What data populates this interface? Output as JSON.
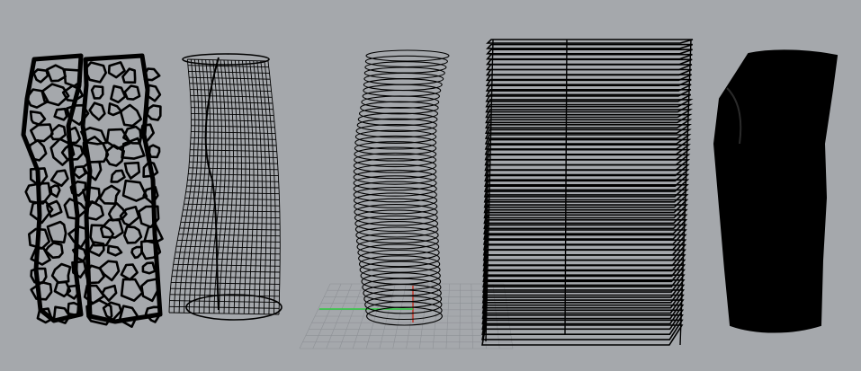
{
  "viewport": {
    "background": "#a5a8ac",
    "grid_color": "#8e9196",
    "axis_x_color": "#c0392b",
    "axis_y_color": "#2ecc40",
    "wire_color": "#000000"
  },
  "objects": [
    {
      "name": "voronoi-lattice-shell",
      "style": "voronoi"
    },
    {
      "name": "wireframe-mesh-shell",
      "style": "mesh"
    },
    {
      "name": "spiral-toolpath",
      "style": "helix"
    },
    {
      "name": "stacked-slice-contours",
      "style": "slices"
    },
    {
      "name": "solid-shaded-shell",
      "style": "solid"
    }
  ]
}
